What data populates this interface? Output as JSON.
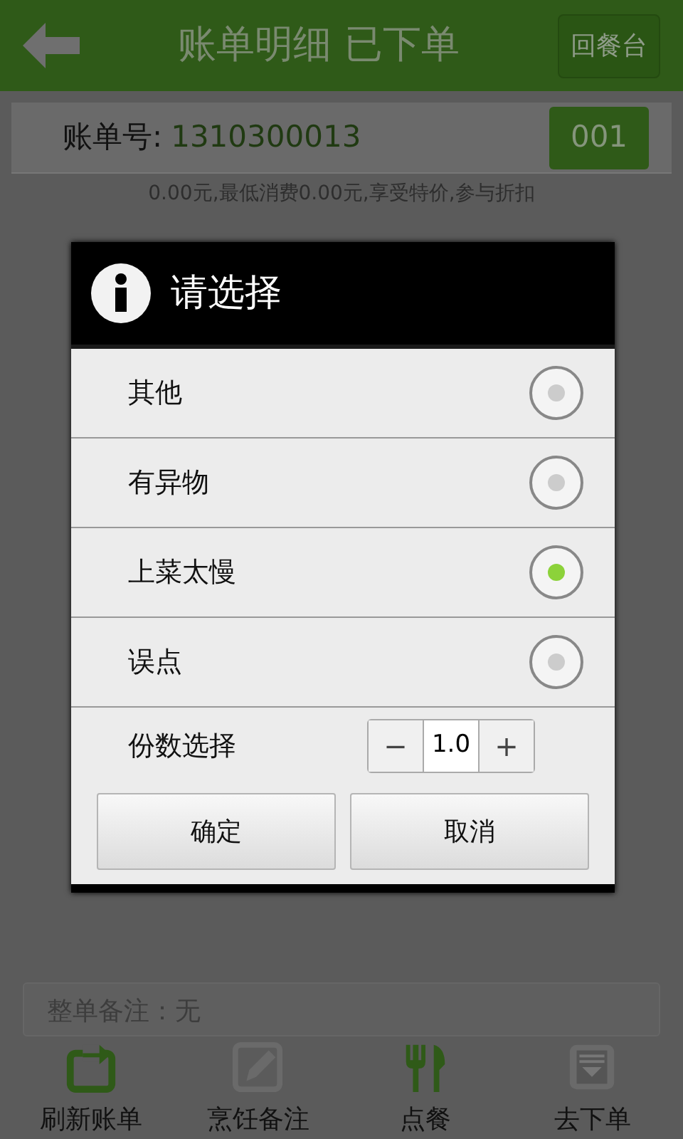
{
  "header": {
    "title": "账单明细 已下单",
    "back_button": "回餐台"
  },
  "bill": {
    "label": "账单号:",
    "number": "1310300013",
    "table_button": "001"
  },
  "summary": "0.00元,最低消费0.00元,享受特价,参与折扣",
  "dialog": {
    "title": "请选择",
    "options": [
      {
        "label": "其他",
        "selected": false
      },
      {
        "label": "有异物",
        "selected": false
      },
      {
        "label": "上菜太慢",
        "selected": true
      },
      {
        "label": "误点",
        "selected": false
      }
    ],
    "quantity": {
      "label": "份数选择",
      "minus": "−",
      "value": "1.0",
      "plus": "+"
    },
    "buttons": [
      "确定",
      "取消"
    ]
  },
  "remark": "整单备注：无",
  "bottom_tabs": [
    {
      "kind": "refresh",
      "label": "刷新账单"
    },
    {
      "kind": "edit",
      "label": "烹饪备注"
    },
    {
      "kind": "meal",
      "label": "点餐"
    },
    {
      "kind": "order",
      "label": "去下单"
    }
  ]
}
